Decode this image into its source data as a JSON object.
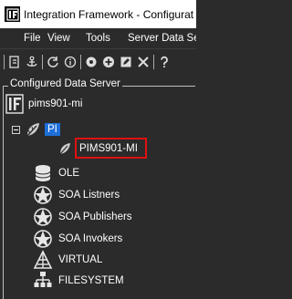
{
  "window": {
    "title": "Integration Framework - Configurat",
    "app_icon": "integration-framework-icon"
  },
  "menu": {
    "items": [
      "File",
      "View",
      "Tools",
      "Server Data Se"
    ]
  },
  "toolbar": {
    "buttons": [
      "export-icon",
      "anchor-icon",
      "refresh-icon",
      "info-icon",
      "record-icon",
      "add-icon",
      "edit-icon",
      "delete-icon",
      "help-icon"
    ]
  },
  "panel": {
    "label": "Configured Data Server",
    "root": {
      "label": "pims901-mi",
      "icon": "integration-framework-icon"
    },
    "pi_node": {
      "label": "PI",
      "icon": "pi-leaf-icon"
    },
    "selected_server": {
      "label": "PIMS901-MI",
      "icon": "pi-server-icon"
    },
    "items": [
      {
        "label": "OLE",
        "icon": "database-icon"
      },
      {
        "label": "SOA Listners",
        "icon": "soa-listener-icon"
      },
      {
        "label": "SOA Publishers",
        "icon": "soa-publisher-icon"
      },
      {
        "label": "SOA Invokers",
        "icon": "soa-invoker-icon"
      },
      {
        "label": "VIRTUAL",
        "icon": "virtual-icon"
      },
      {
        "label": "FILESYSTEM",
        "icon": "filesystem-icon"
      }
    ]
  },
  "colors": {
    "background": "#2b2b2b",
    "selection_outline": "#e01010",
    "pi_highlight": "#1e6fd9"
  }
}
